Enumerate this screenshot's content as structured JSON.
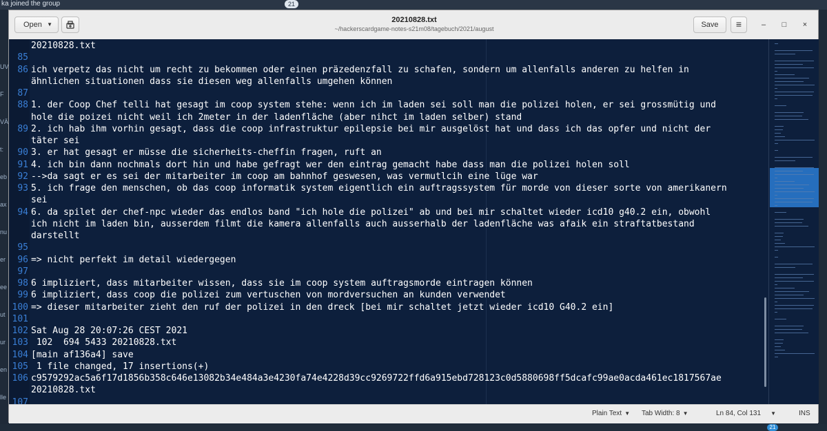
{
  "background": {
    "notification": "ka joined the group",
    "badge_top": "21",
    "badge_bottom": "21",
    "left_fragments": [
      "UV",
      "F",
      "VÄ",
      "t:",
      "eb",
      "ax",
      "nu",
      "er",
      "ee",
      "ut",
      "ur",
      "en",
      "lle"
    ]
  },
  "window": {
    "title": "20210828.txt",
    "path": "~/hackerscardgame-notes-s21m08/tagebuch/2021/august",
    "open_label": "Open",
    "save_label": "Save",
    "menu_icon": "hamburger-menu-icon",
    "minimize_icon": "–",
    "maximize_icon": "□",
    "close_icon": "×"
  },
  "editor": {
    "lines": [
      {
        "n": "",
        "t": "20210828.txt"
      },
      {
        "n": "85",
        "t": ""
      },
      {
        "n": "86",
        "t": "ich verpetz das nicht um recht zu bekommen oder einen präzedenzfall zu schafen, sondern um allenfalls anderen zu helfen in"
      },
      {
        "n": "",
        "t": "ähnlichen situationen dass sie diesen weg allenfalls umgehen können"
      },
      {
        "n": "87",
        "t": ""
      },
      {
        "n": "88",
        "t": "1. der Coop Chef telli hat gesagt im coop system stehe: wenn ich im laden sei soll man die polizei holen, er sei grossmütig und"
      },
      {
        "n": "",
        "t": "hole die poizei nicht weil ich 2meter in der ladenfläche (aber nihct im laden selber) stand"
      },
      {
        "n": "89",
        "t": "2. ich hab ihm vorhin gesagt, dass die coop infrastruktur epilepsie bei mir ausgelöst hat und dass ich das opfer und nicht der"
      },
      {
        "n": "",
        "t": "täter sei"
      },
      {
        "n": "90",
        "t": "3. er hat gesagt er müsse die sicherheits-cheffin fragen, ruft an"
      },
      {
        "n": "91",
        "t": "4. ich bin dann nochmals dort hin und habe gefragt wer den eintrag gemacht habe dass man die polizei holen soll"
      },
      {
        "n": "92",
        "t": "-->da sagt er es sei der mitarbeiter im coop am bahnhof geswesen, was vermutlcih eine lüge war"
      },
      {
        "n": "93",
        "t": "5. ich frage den menschen, ob das coop informatik system eigentlich ein auftragssystem für morde von dieser sorte von amerikanern"
      },
      {
        "n": "",
        "t": "sei"
      },
      {
        "n": "94",
        "t": "6. da spilet der chef-npc wieder das endlos band \"ich hole die polizei\" ab und bei mir schaltet wieder icd10 g40.2 ein, obwohl"
      },
      {
        "n": "",
        "t": "ich nicht im laden bin, ausserdem filmt die kamera allenfalls auch ausserhalb der ladenfläche was afaik ein straftatbestand"
      },
      {
        "n": "",
        "t": "darstellt"
      },
      {
        "n": "95",
        "t": ""
      },
      {
        "n": "96",
        "t": "=> nicht perfekt im detail wiedergegen"
      },
      {
        "n": "97",
        "t": ""
      },
      {
        "n": "98",
        "t": "6 impliziert, dass mitarbeiter wissen, dass sie im coop system auftragsmorde eintragen können"
      },
      {
        "n": "99",
        "t": "6 impliziert, dass coop die polizei zum vertuschen von mordversuchen an kunden verwendet"
      },
      {
        "n": "100",
        "t": "=> dieser mitarbeiter zieht den ruf der polizei in den dreck [bei mir schaltet jetzt wieder icd10 G40.2 ein]"
      },
      {
        "n": "101",
        "t": ""
      },
      {
        "n": "102",
        "t": "Sat Aug 28 20:07:26 CEST 2021"
      },
      {
        "n": "103",
        "t": " 102  694 5433 20210828.txt"
      },
      {
        "n": "104",
        "t": "[main af136a4] save"
      },
      {
        "n": "105",
        "t": " 1 file changed, 17 insertions(+)"
      },
      {
        "n": "106",
        "t": "c9579292ac5a6f17d1856b358c646e13082b34e484a3e4230fa74e4228d39cc9269722ffd6a915ebd728123c0d5880698ff5dcafc99ae0acda461ec1817567ae"
      },
      {
        "n": "",
        "t": "20210828.txt"
      },
      {
        "n": "107",
        "t": ""
      }
    ]
  },
  "status": {
    "language": "Plain Text",
    "tab_width": "Tab Width: 8",
    "position": "Ln 84, Col 131",
    "mode": "INS"
  },
  "colors": {
    "editor_bg": "#0d1f3c",
    "line_number": "#3a7fd6",
    "text": "#ffffff",
    "minimap_highlight": "#2c7dd4"
  }
}
